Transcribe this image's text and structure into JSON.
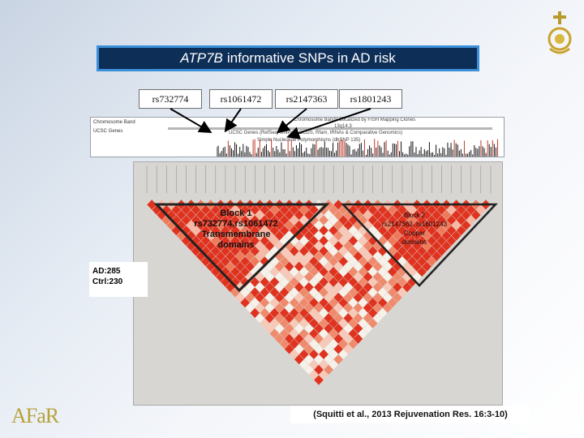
{
  "title": {
    "gene": "ATP7B",
    "rest": "informative SNPs in AD risk"
  },
  "snps": [
    "rs732774",
    "rs1061472",
    "rs2147363",
    "rs1801243"
  ],
  "browser": {
    "track_labels": [
      "Chromosome Band",
      "UCSC Genes"
    ],
    "band_header": "Chromosome Bands Localized by FISH Mapping Clones",
    "band_name": "13q14.3",
    "genes_note": "UCSC Genes (RefSeq, UniProt, CCDS, Rfam, tRNAs & Comparative Genomics)",
    "snp_track": "Simple Nucleotide Polymorphisms (dbSNP 135)"
  },
  "blocks": [
    {
      "lines": [
        "Block 1",
        "rs732774,rs1061472",
        "Transmembrane",
        "domains"
      ]
    },
    {
      "lines": [
        "Block 2",
        "rs2147363, rs1801243",
        "Copper",
        "domains"
      ]
    }
  ],
  "sample": {
    "ad": "AD:285",
    "ctrl": "Ctrl:230"
  },
  "citation": "(Squitti et al., 2013 Rejuvenation Res. 16:3-10)",
  "logo_text": "AFaR",
  "colors": {
    "title_bg": "#0d2e57",
    "title_border": "#3b8fd9",
    "ld_high": "#e0331f",
    "ld_low": "#f6f2ea"
  }
}
